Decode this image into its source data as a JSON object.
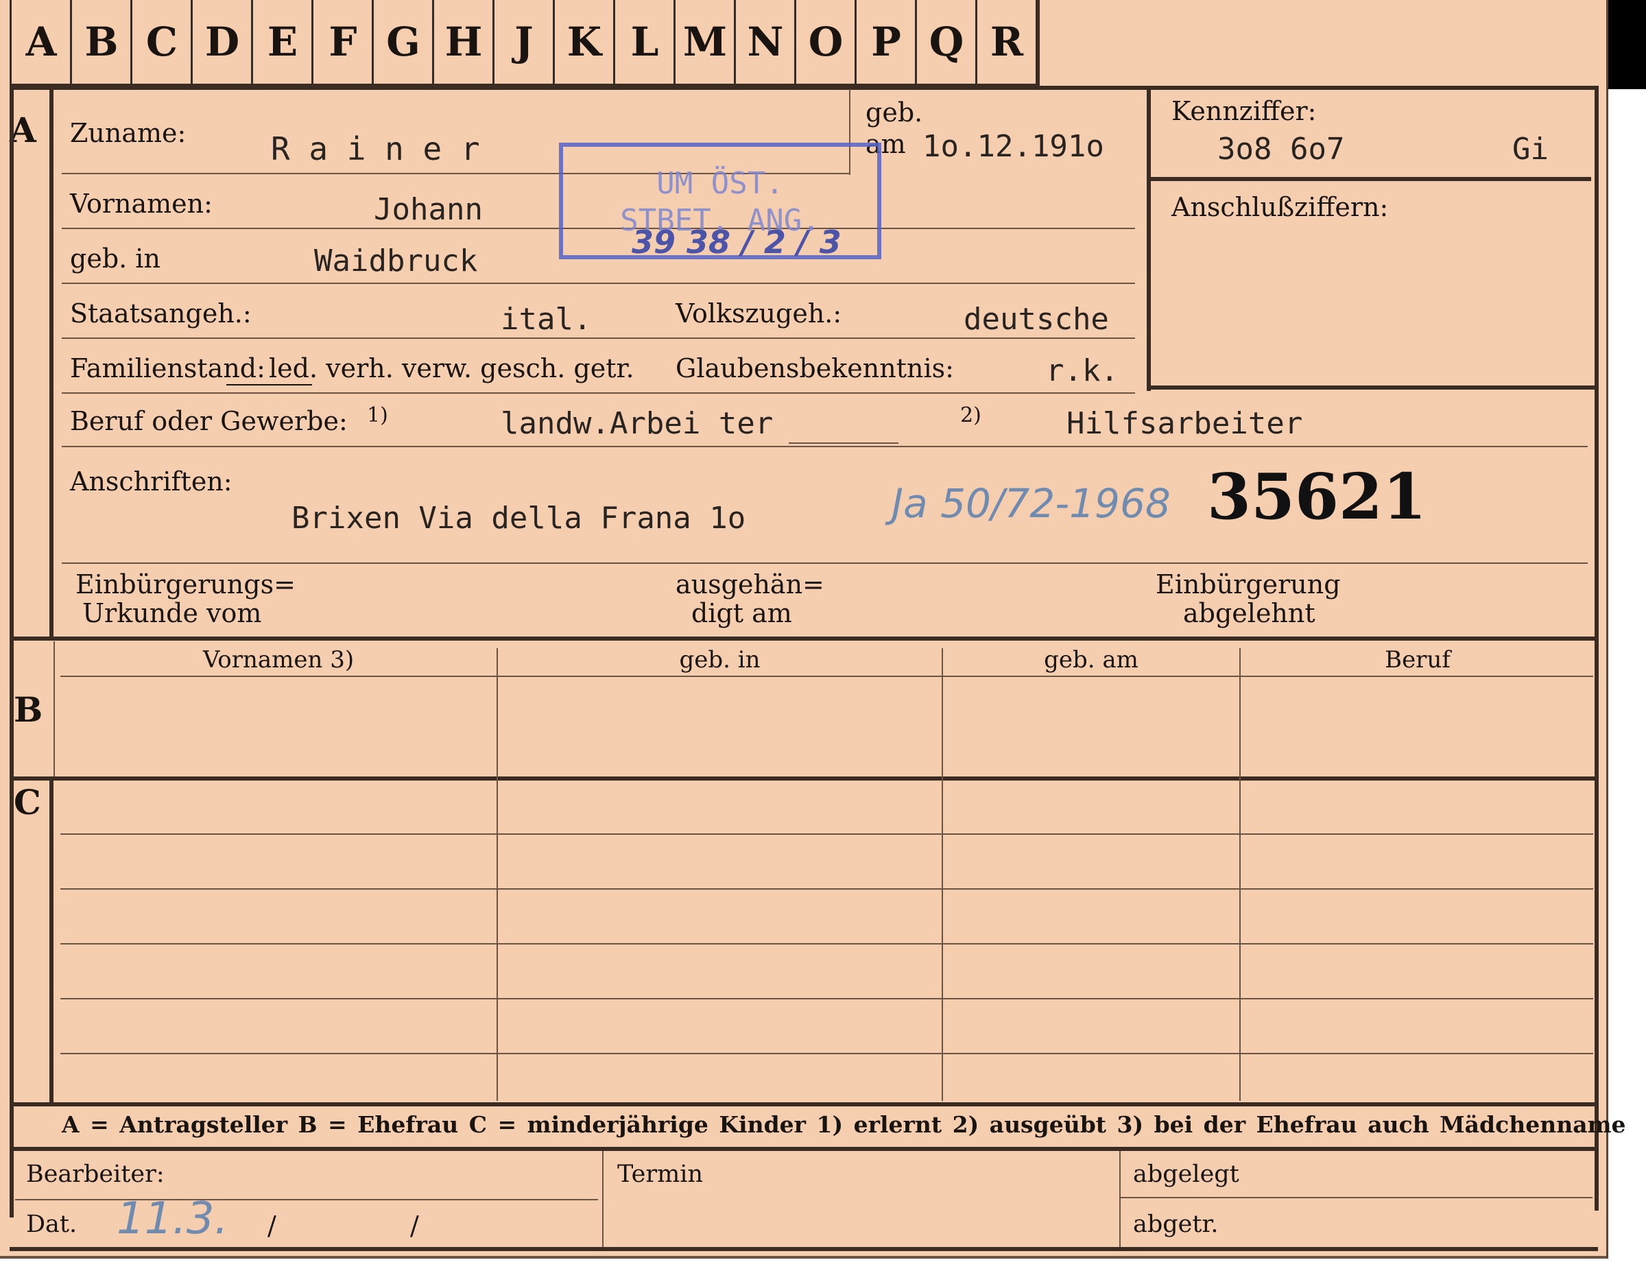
{
  "alphabet_tabs": [
    "A",
    "B",
    "C",
    "D",
    "E",
    "F",
    "G",
    "H",
    "J",
    "K",
    "L",
    "M",
    "N",
    "O",
    "P",
    "Q",
    "R"
  ],
  "sections": {
    "a": "A",
    "b": "B",
    "c": "C"
  },
  "fields": {
    "zuname_label": "Zuname:",
    "zuname_value": "R a i n e r",
    "geb_label": "geb.",
    "geb_am_label": "am",
    "geb_am_value": "1o.12.191o",
    "vornamen_label": "Vornamen:",
    "vornamen_value": "Johann",
    "geb_in_label": "geb. in",
    "geb_in_value": "Waidbruck",
    "staatsangeh_label": "Staatsangeh.:",
    "staatsangeh_value": "ital.",
    "volkszugeh_label": "Volkszugeh.:",
    "volkszugeh_value": "deutsche",
    "familienstand_label": "Familienstand:",
    "familienstand_options": "led. verh. verw. gesch. getr.",
    "glaubens_label": "Glaubensbekenntnis:",
    "glaubens_value": "r.k.",
    "beruf_label": "Beruf oder Gewerbe:",
    "beruf_note1": "1)",
    "beruf_value1": "landw.Arbei ter",
    "beruf_note2": "2)",
    "beruf_value2": "Hilfsarbeiter",
    "anschriften_label": "Anschriften:",
    "anschriften_value": "Brixen Via della Frana 1o",
    "file_number": "35621",
    "handwritten_ref": "Ja 50/72-1968",
    "einbuergerung_urkunde_l1": "Einbürgerungs=",
    "einbuergerung_urkunde_l2": "Urkunde vom",
    "ausgehaendigt_l1": "ausgehän=",
    "ausgehaendigt_l2": "digt am",
    "einbuergerung_abgelehnt_l1": "Einbürgerung",
    "einbuergerung_abgelehnt_l2": "abgelehnt"
  },
  "kennziffer": {
    "label": "Kennziffer:",
    "value": "3o8 6o7",
    "suffix": "Gi",
    "anschluss_label": "Anschlußziffern:"
  },
  "stamp": {
    "line1": "UM ÖST.",
    "line2": "STBET. ANG.",
    "line3": "39 38 / 2 / 3"
  },
  "table_headers": [
    "Vornamen 3)",
    "geb. in",
    "geb. am",
    "Beruf"
  ],
  "legend": "A = Antragsteller   B = Ehefrau   C = minderjährige Kinder   1) erlernt   2) ausgeübt   3) bei der Ehefrau auch Mädchenname",
  "footer": {
    "bearbeiter_label": "Bearbeiter:",
    "termin_label": "Termin",
    "abgelegt_label": "abgelegt",
    "dat_label": "Dat.",
    "dat_value": "11.3.",
    "dat_sep1": "/",
    "dat_sep2": "/",
    "abgetr_label": "abgetr."
  },
  "colors": {
    "card": "#f5ceb0",
    "ink": "#1a1410",
    "stamp": "#5563c8",
    "pencil": "#6f8bb0"
  }
}
